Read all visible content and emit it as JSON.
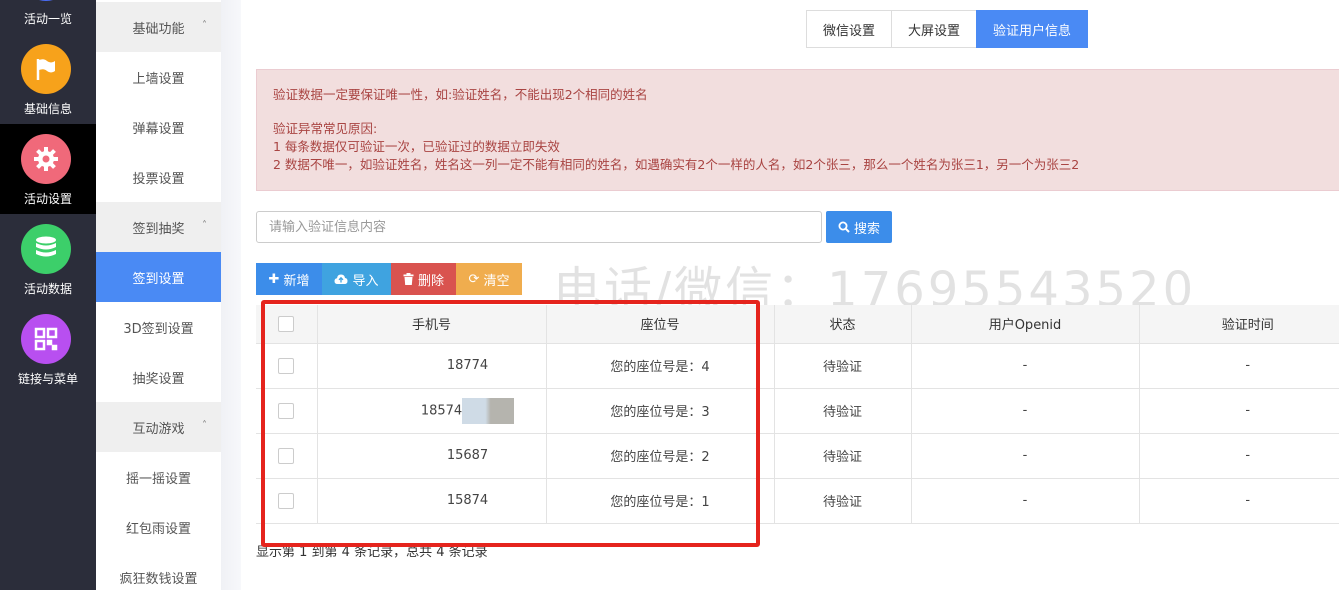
{
  "rail": {
    "items": [
      {
        "label": "活动一览",
        "icon": "list-icon",
        "color": "#4a6cf7"
      },
      {
        "label": "基础信息",
        "icon": "flag-icon",
        "color": "#f7a21b"
      },
      {
        "label": "活动设置",
        "icon": "gear-icon",
        "color": "#f0697a"
      },
      {
        "label": "活动数据",
        "icon": "database-icon",
        "color": "#3ccf6a"
      },
      {
        "label": "链接与菜单",
        "icon": "qrcode-icon",
        "color": "#b84ff0"
      }
    ]
  },
  "submenu": {
    "groups": [
      {
        "title": "基础功能",
        "items": [
          "上墙设置",
          "弹幕设置",
          "投票设置"
        ]
      },
      {
        "title": "签到抽奖",
        "items": [
          "签到设置",
          "3D签到设置",
          "抽奖设置"
        ]
      },
      {
        "title": "互动游戏",
        "items": [
          "摇一摇设置",
          "红包雨设置",
          "疯狂数钱设置"
        ]
      }
    ],
    "active_item": "签到设置"
  },
  "tabs": [
    "微信设置",
    "大屏设置",
    "验证用户信息"
  ],
  "active_tab": "验证用户信息",
  "alert": {
    "line1": "验证数据一定要保证唯一性，如:验证姓名，不能出现2个相同的姓名",
    "line2": "验证异常常见原因:",
    "line3": "1 每条数据仅可验证一次，已验证过的数据立即失效",
    "line4": "2 数据不唯一，如验证姓名，姓名这一列一定不能有相同的姓名，如遇确实有2个一样的人名，如2个张三，那么一个姓名为张三1，另一个为张三2"
  },
  "search": {
    "placeholder": "请输入验证信息内容",
    "button": "搜索"
  },
  "toolbar": {
    "add": "新增",
    "import": "导入",
    "delete": "删除",
    "clear": "清空"
  },
  "watermark": "电话/微信：17695543520",
  "table": {
    "headers": [
      "手机号",
      "座位号",
      "状态",
      "用户Openid",
      "验证时间"
    ],
    "rows": [
      {
        "phone": "18774",
        "seat": "您的座位号是：4",
        "status": "待验证",
        "openid": "-",
        "time": "-"
      },
      {
        "phone": "18574",
        "seat": "您的座位号是：3",
        "status": "待验证",
        "openid": "-",
        "time": "-"
      },
      {
        "phone": "15687",
        "seat": "您的座位号是：2",
        "status": "待验证",
        "openid": "-",
        "time": "-"
      },
      {
        "phone": "15874",
        "seat": "您的座位号是：1",
        "status": "待验证",
        "openid": "-",
        "time": "-"
      }
    ]
  },
  "footer": "显示第 1 到第 4 条记录，总共 4 条记录"
}
